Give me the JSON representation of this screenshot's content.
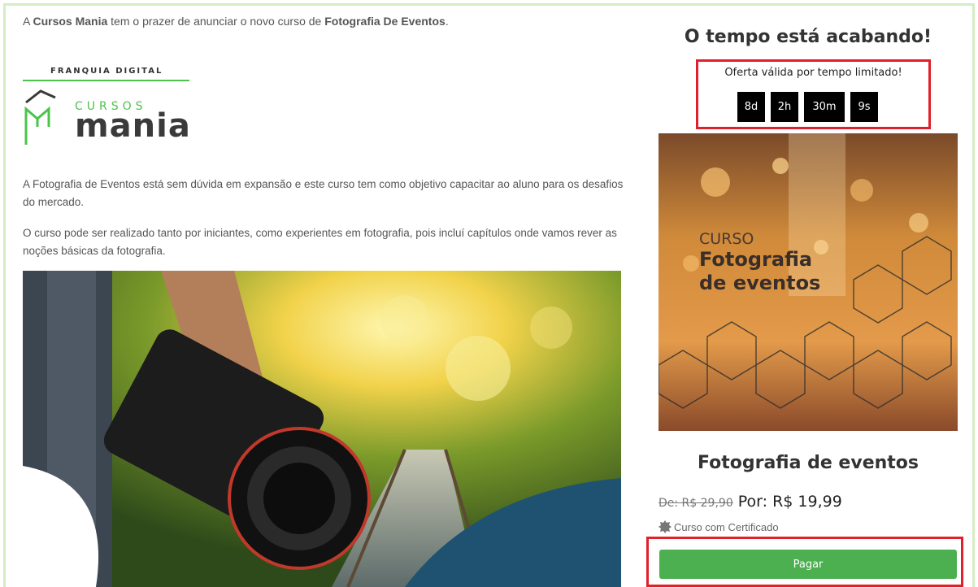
{
  "intro": {
    "prefix": "A ",
    "brand": "Cursos Mania",
    "middle": " tem o prazer de anunciar o novo curso de ",
    "course": "Fotografia De Eventos",
    "suffix": "."
  },
  "logo": {
    "franchise_a": "FRANQUIA ",
    "franchise_b": "DIGITAL",
    "cursos": "CURSOS",
    "mania": "mania",
    "accent": "#4bc34b"
  },
  "description": {
    "p1": "A Fotografia de Eventos está sem dúvida em expansão e este curso tem como objetivo capacitar ao aluno para os desafios do mercado.",
    "p2": "O curso pode ser realizado tanto por iniciantes, como experientes em fotografia, pois incluí capítulos onde vamos rever as noções básicas da fotografia."
  },
  "sidebar": {
    "urgency_title": "O tempo está acabando!",
    "offer_text": "Oferta válida por tempo limitado!",
    "timer": [
      "8d",
      "2h",
      "30m",
      "9s"
    ],
    "course_image": {
      "line1": "CURSO",
      "line2": "Fotografia",
      "line3": "de eventos"
    },
    "product_title": "Fotografia de eventos",
    "old_price": "De: R$ 29,90",
    "new_price": " Por: R$ 19,99",
    "certificate": "Curso com Certificado",
    "pay_label": "Pagar"
  },
  "colors": {
    "frame_border": "#d6ecc4",
    "highlight_border": "#e0202a",
    "pay_button": "#4caf50",
    "timer_bg": "#000000"
  }
}
